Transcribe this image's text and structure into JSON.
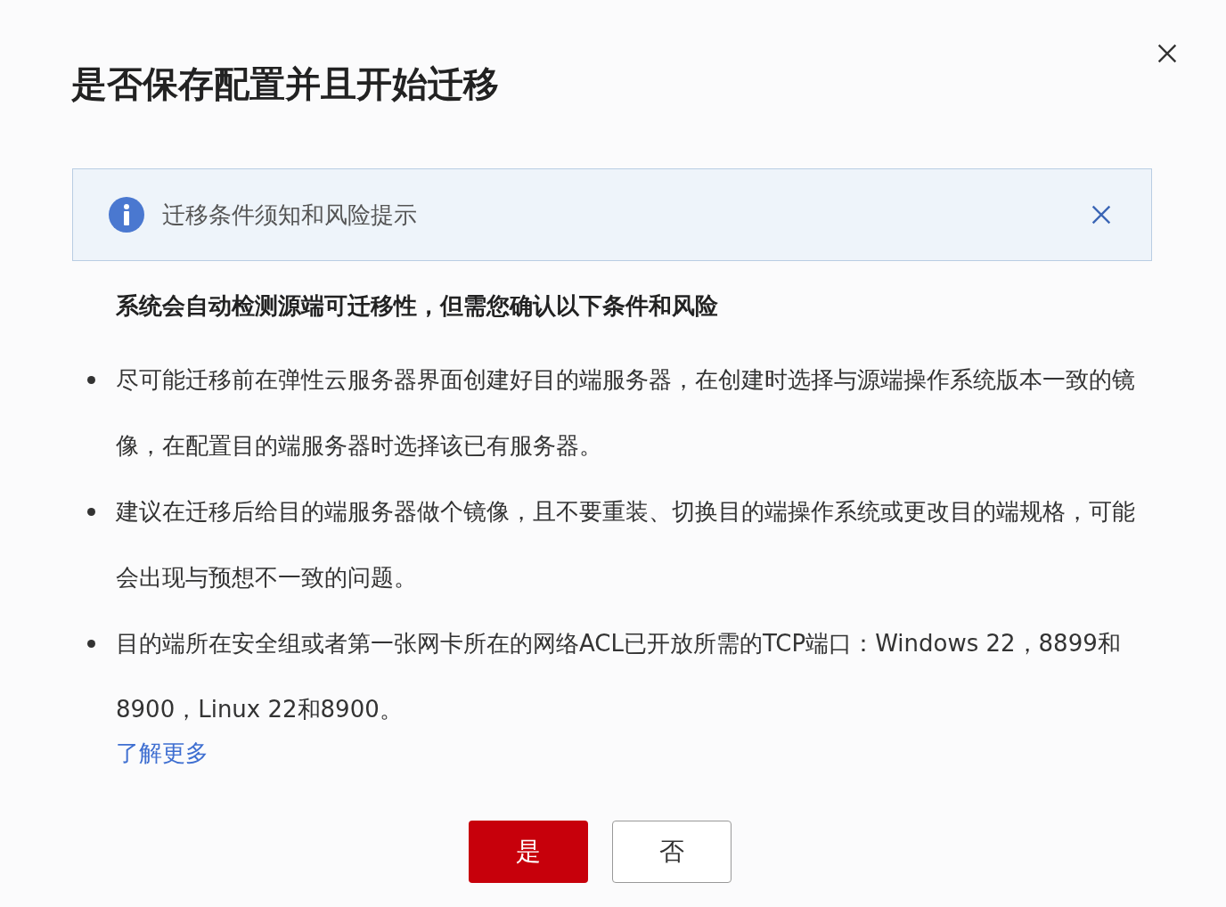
{
  "dialog": {
    "title": "是否保存配置并且开始迁移"
  },
  "alert": {
    "text": "迁移条件须知和风险提示"
  },
  "intro": "系统会自动检测源端可迁移性，但需您确认以下条件和风险",
  "bullets": [
    "尽可能迁移前在弹性云服务器界面创建好目的端服务器，在创建时选择与源端操作系统版本一致的镜像，在配置目的端服务器时选择该已有服务器。",
    "建议在迁移后给目的端服务器做个镜像，且不要重装、切换目的端操作系统或更改目的端规格，可能会出现与预想不一致的问题。",
    "目的端所在安全组或者第一张网卡所在的网络ACL已开放所需的TCP端口：Windows 22，8899和8900，Linux 22和8900。"
  ],
  "link": "了解更多",
  "buttons": [
    {
      "label": "是",
      "kind": "primary"
    },
    {
      "label": "否",
      "kind": "secondary"
    }
  ]
}
